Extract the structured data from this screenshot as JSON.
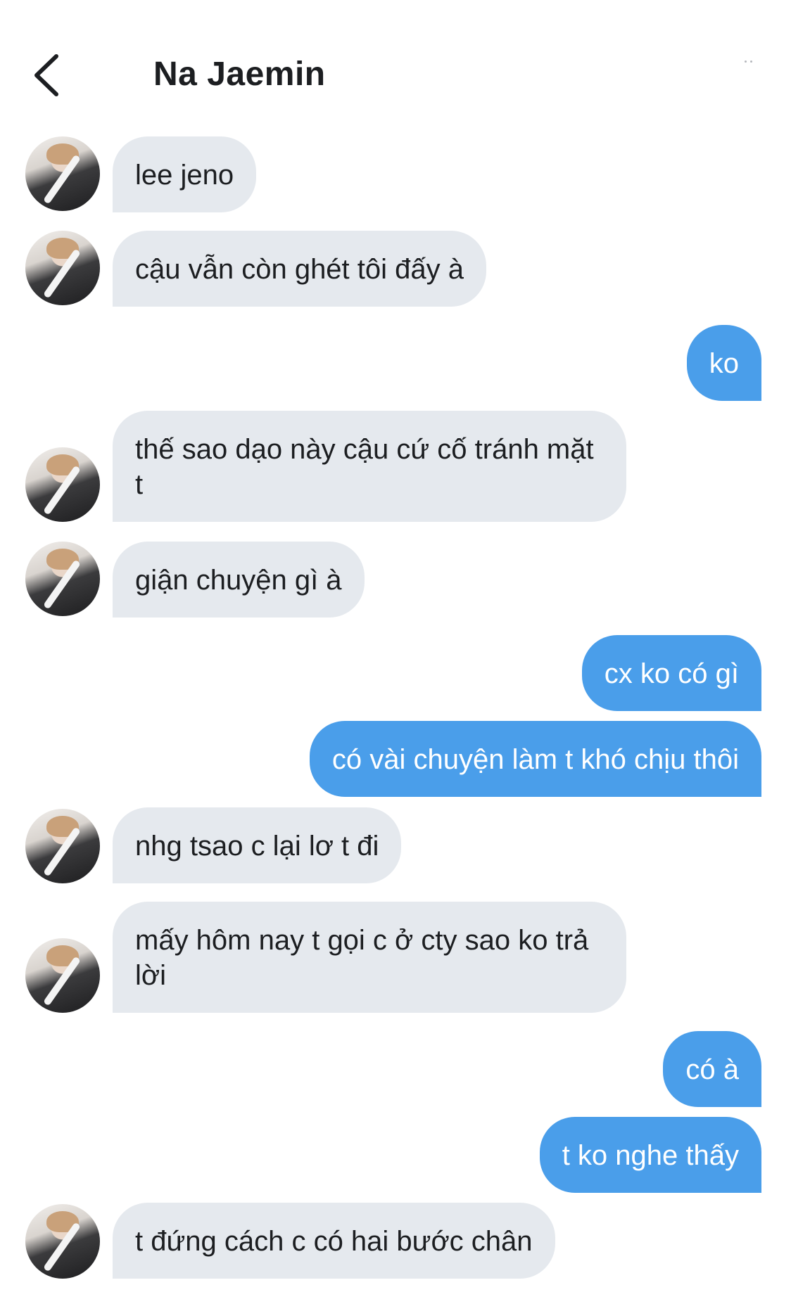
{
  "header": {
    "title": "Na Jaemin"
  },
  "messages": [
    {
      "side": "in",
      "text": "lee jeno"
    },
    {
      "side": "in",
      "text": "cậu vẫn còn ghét tôi đấy à"
    },
    {
      "side": "out",
      "text": "ko"
    },
    {
      "side": "in",
      "text": "thế sao dạo này cậu cứ cố tránh mặt t"
    },
    {
      "side": "in",
      "text": "giận chuyện gì à"
    },
    {
      "side": "out",
      "text": "cx ko có gì"
    },
    {
      "side": "out",
      "text": "có vài chuyện làm t khó chịu thôi"
    },
    {
      "side": "in",
      "text": "nhg tsao c lại lơ t đi"
    },
    {
      "side": "in",
      "text": "mấy hôm nay t gọi c ở cty sao ko trả lời"
    },
    {
      "side": "out",
      "text": "có à"
    },
    {
      "side": "out",
      "text": "t ko nghe thấy"
    },
    {
      "side": "in",
      "text": "t đứng cách c có hai bước chân"
    }
  ],
  "colors": {
    "incoming_bubble": "#e5e9ee",
    "outgoing_bubble": "#4a9eea",
    "title": "#1c1e21"
  }
}
